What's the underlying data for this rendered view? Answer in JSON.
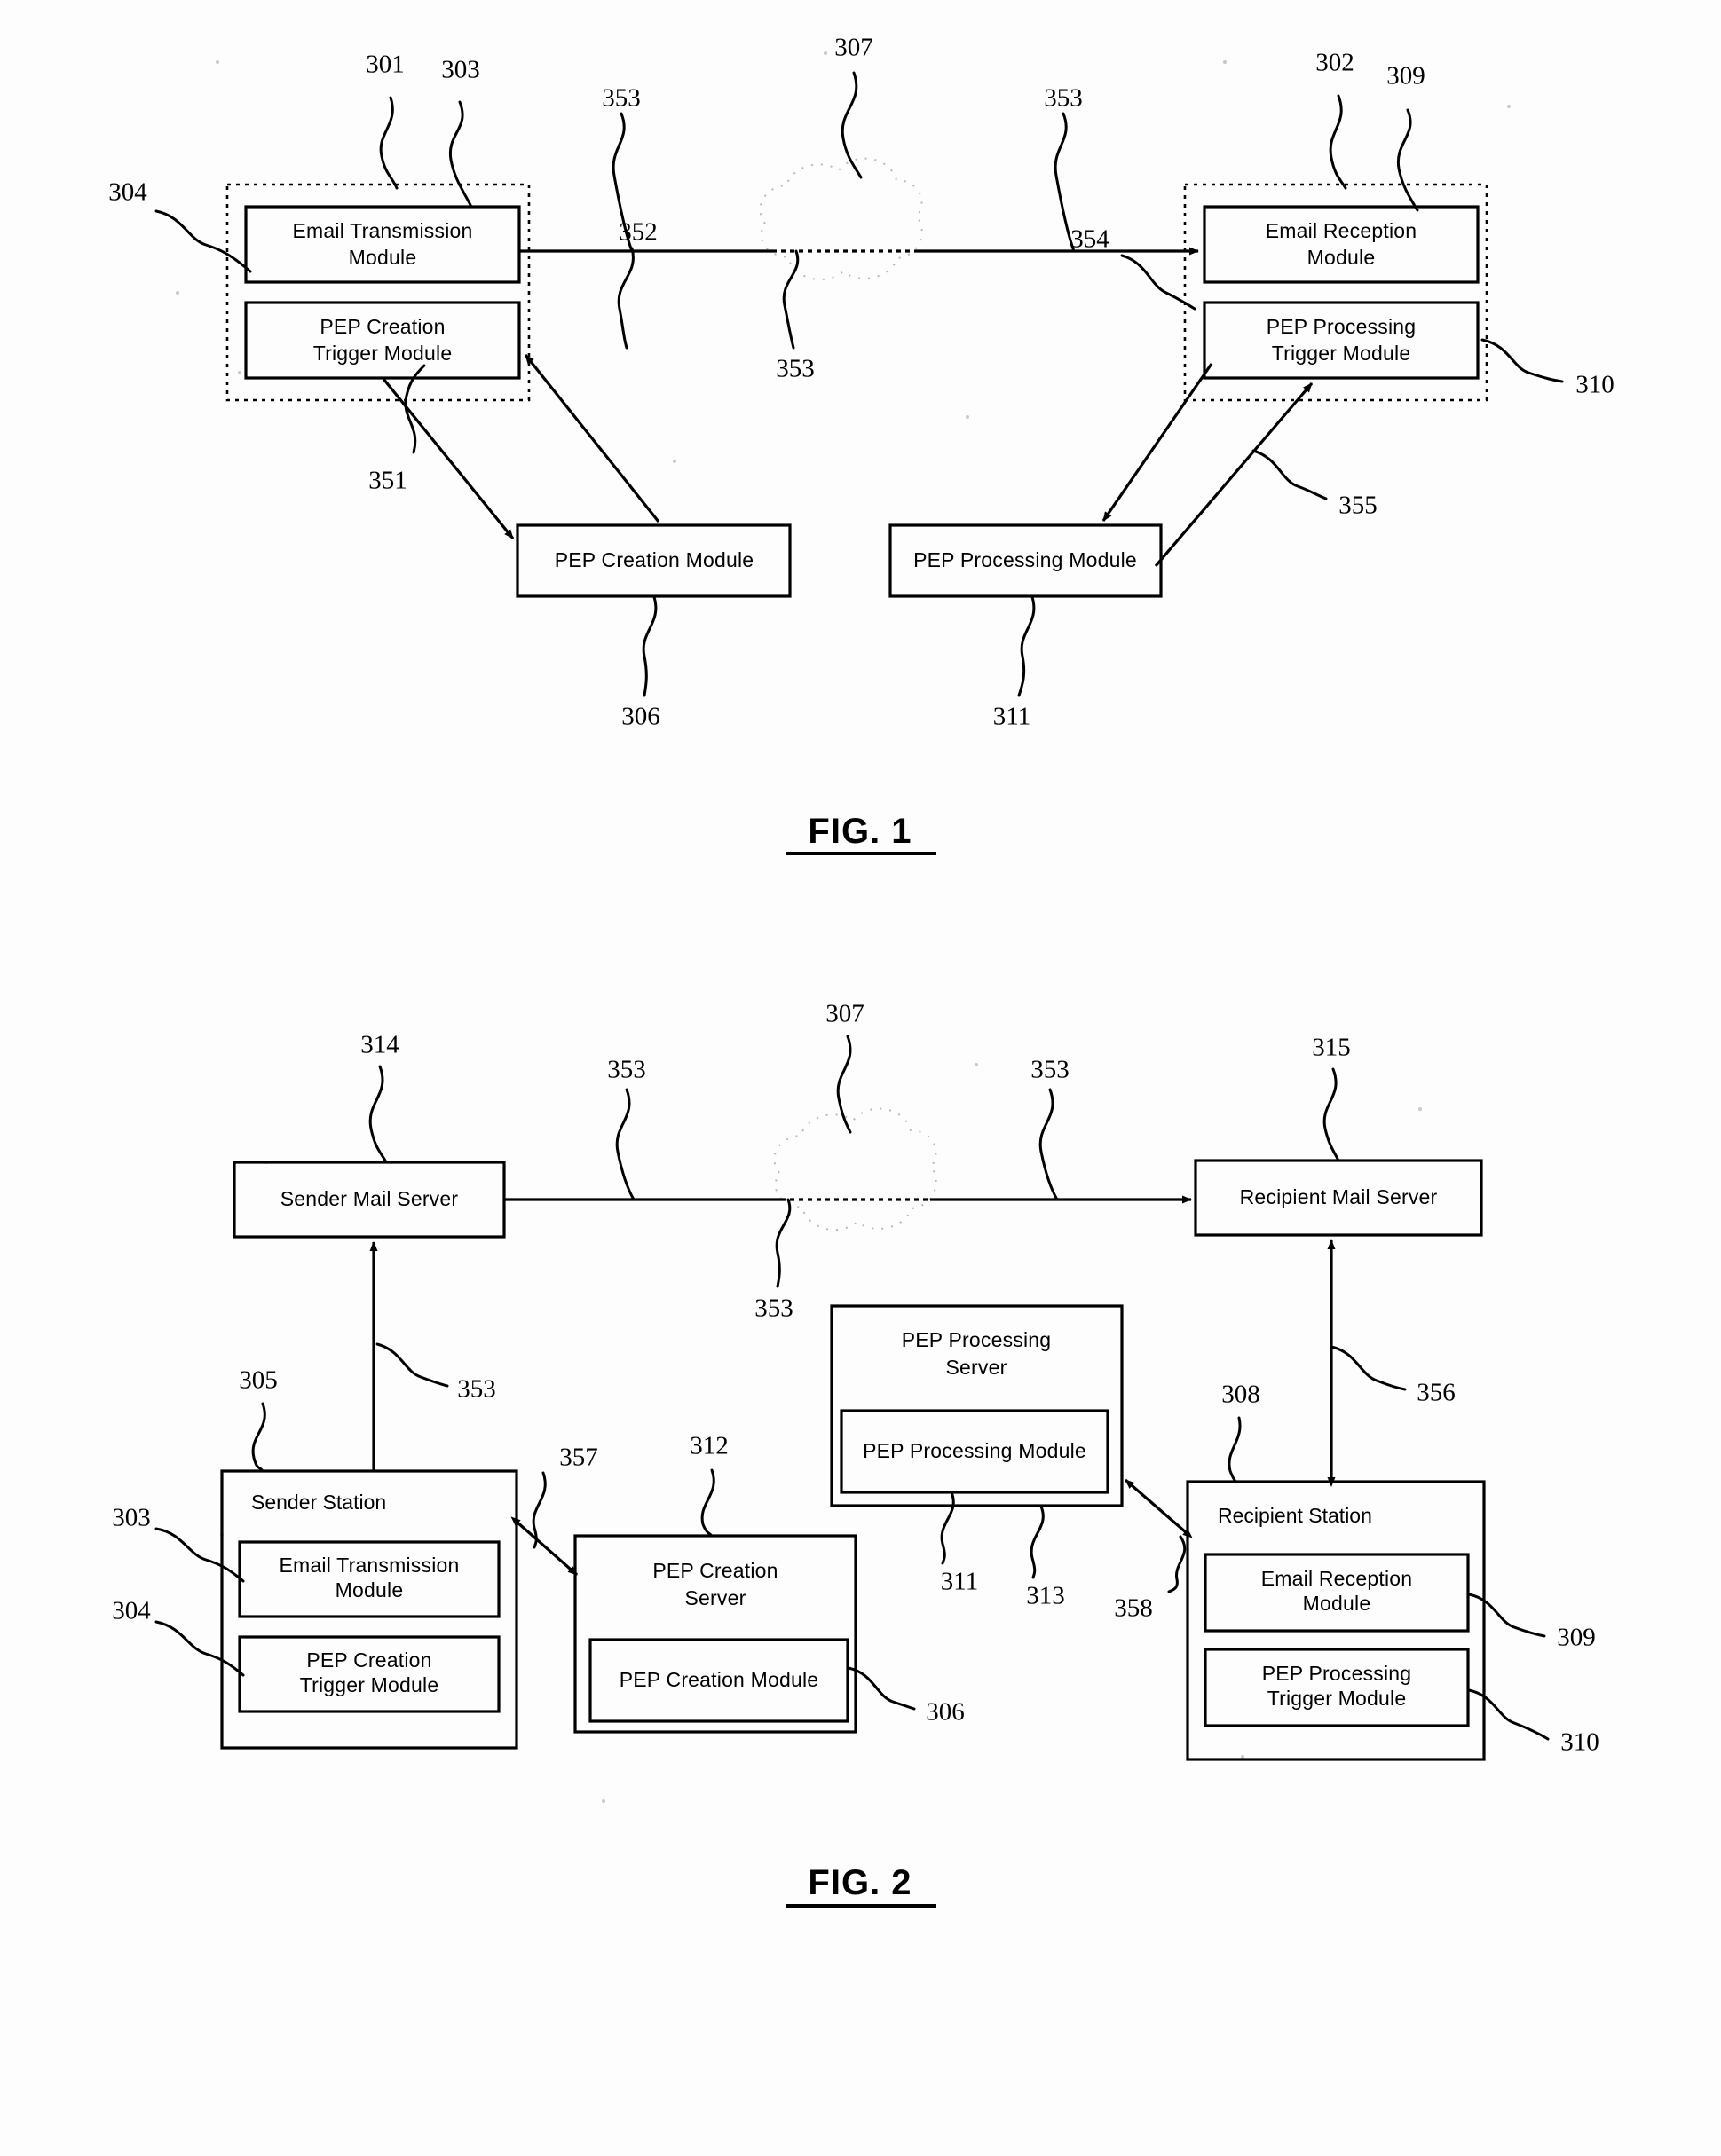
{
  "document": {
    "type": "patent-figure-sheet",
    "figures": [
      {
        "caption": "FIG. 1",
        "boxes": [
          {
            "id": "f1-email-transmission",
            "label_line1": "Email Transmission",
            "label_line2": "Module"
          },
          {
            "id": "f1-pep-creation-trigger",
            "label_line1": "PEP Creation",
            "label_line2": "Trigger Module"
          },
          {
            "id": "f1-email-reception",
            "label_line1": "Email Reception",
            "label_line2": "Module"
          },
          {
            "id": "f1-pep-processing-trigger",
            "label_line1": "PEP Processing",
            "label_line2": "Trigger Module"
          },
          {
            "id": "f1-pep-creation-module",
            "label_line1": "PEP Creation Module",
            "label_line2": ""
          },
          {
            "id": "f1-pep-processing-module",
            "label_line1": "PEP Processing Module",
            "label_line2": ""
          }
        ],
        "reference_numerals": [
          "301",
          "303",
          "307",
          "353",
          "353",
          "302",
          "309",
          "304",
          "352",
          "353",
          "354",
          "310",
          "351",
          "355",
          "306",
          "311"
        ]
      },
      {
        "caption": "FIG. 2",
        "boxes": [
          {
            "id": "f2-sender-mail-server",
            "label_line1": "Sender Mail Server",
            "label_line2": ""
          },
          {
            "id": "f2-recipient-mail-server",
            "label_line1": "Recipient Mail Server",
            "label_line2": ""
          },
          {
            "id": "f2-sender-station",
            "label_line1": "Sender Station",
            "label_line2": ""
          },
          {
            "id": "f2-email-transmission",
            "label_line1": "Email Transmission",
            "label_line2": "Module"
          },
          {
            "id": "f2-pep-creation-trigger",
            "label_line1": "PEP Creation",
            "label_line2": "Trigger Module"
          },
          {
            "id": "f2-pep-creation-server",
            "label_line1": "PEP Creation",
            "label_line2": "Server"
          },
          {
            "id": "f2-pep-creation-module",
            "label_line1": "PEP Creation Module",
            "label_line2": ""
          },
          {
            "id": "f2-pep-processing-server",
            "label_line1": "PEP Processing",
            "label_line2": "Server"
          },
          {
            "id": "f2-pep-processing-module",
            "label_line1": "PEP Processing Module",
            "label_line2": ""
          },
          {
            "id": "f2-recipient-station",
            "label_line1": "Recipient Station",
            "label_line2": ""
          },
          {
            "id": "f2-email-reception",
            "label_line1": "Email Reception",
            "label_line2": "Module"
          },
          {
            "id": "f2-pep-processing-trigger",
            "label_line1": "PEP Processing",
            "label_line2": "Trigger Module"
          }
        ],
        "reference_numerals": [
          "314",
          "307",
          "353",
          "353",
          "315",
          "353",
          "305",
          "353",
          "356",
          "308",
          "303",
          "357",
          "312",
          "311",
          "313",
          "358",
          "304",
          "309",
          "306",
          "310"
        ]
      }
    ]
  },
  "fig1": {
    "caption": "FIG. 1",
    "sender_station": {
      "email_transmission": {
        "l1": "Email Transmission",
        "l2": "Module"
      },
      "pep_creation_trigger": {
        "l1": "PEP Creation",
        "l2": "Trigger Module"
      }
    },
    "recipient_station": {
      "email_reception": {
        "l1": "Email Reception",
        "l2": "Module"
      },
      "pep_processing_trigger": {
        "l1": "PEP Processing",
        "l2": "Trigger Module"
      }
    },
    "pep_creation_module": "PEP Creation Module",
    "pep_processing_module": "PEP Processing Module",
    "refs": {
      "n301": "301",
      "n303": "303",
      "n307": "307",
      "n353_left": "353",
      "n353_right": "353",
      "n353_cloud": "353",
      "n302": "302",
      "n309": "309",
      "n304": "304",
      "n352": "352",
      "n354": "354",
      "n310": "310",
      "n351": "351",
      "n355": "355",
      "n306": "306",
      "n311": "311"
    }
  },
  "fig2": {
    "caption": "FIG. 2",
    "sender_mail_server": "Sender Mail Server",
    "recipient_mail_server": "Recipient Mail Server",
    "sender_station": {
      "title": "Sender Station",
      "email_transmission": {
        "l1": "Email Transmission",
        "l2": "Module"
      },
      "pep_creation_trigger": {
        "l1": "PEP Creation",
        "l2": "Trigger Module"
      }
    },
    "pep_creation_server": {
      "l1": "PEP Creation",
      "l2": "Server",
      "module": "PEP Creation Module"
    },
    "pep_processing_server": {
      "l1": "PEP Processing",
      "l2": "Server",
      "module": "PEP Processing Module"
    },
    "recipient_station": {
      "title": "Recipient Station",
      "email_reception": {
        "l1": "Email Reception",
        "l2": "Module"
      },
      "pep_processing_trigger": {
        "l1": "PEP Processing",
        "l2": "Trigger Module"
      }
    },
    "refs": {
      "n314": "314",
      "n307": "307",
      "n353_a": "353",
      "n353_b": "353",
      "n353_cloud": "353",
      "n353_up": "353",
      "n315": "315",
      "n305": "305",
      "n356": "356",
      "n308": "308",
      "n303": "303",
      "n304": "304",
      "n357": "357",
      "n312": "312",
      "n311": "311",
      "n313": "313",
      "n358": "358",
      "n309": "309",
      "n310": "310",
      "n306": "306"
    }
  },
  "colors": {
    "ink": "#000000",
    "paper": "#ffffff",
    "cloud_outline": "#b9b9b9"
  }
}
